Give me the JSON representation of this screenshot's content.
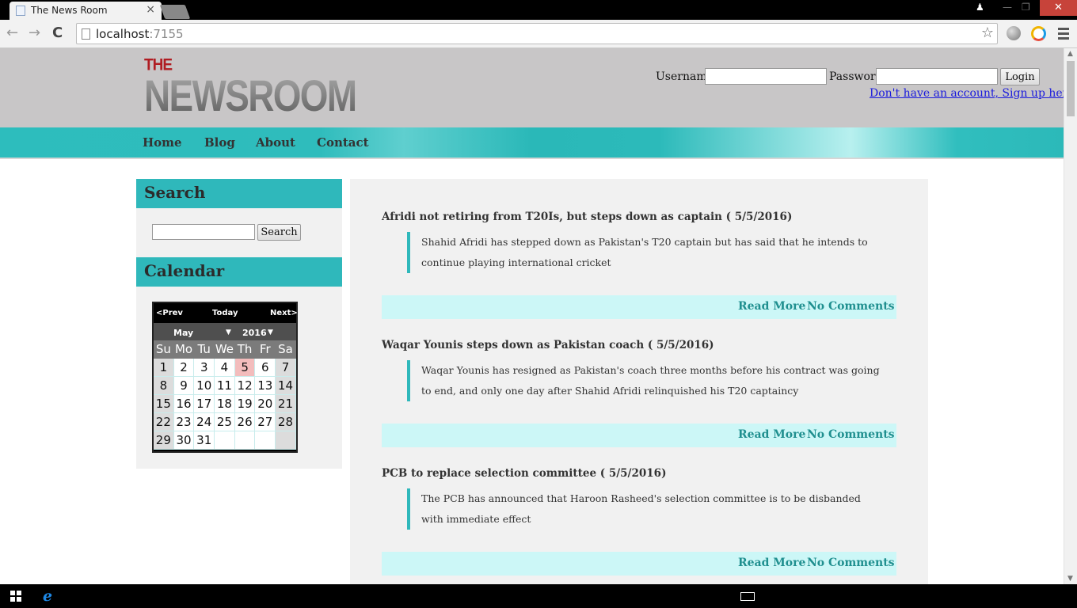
{
  "browser": {
    "tab_title": "The News Room",
    "tab_close": "×",
    "url_host": "localhost",
    "url_port": ":7155",
    "back": "←",
    "forward": "→",
    "reload": "C",
    "star": "☆"
  },
  "window": {
    "user_glyph": "♟",
    "min": "—",
    "max": "❐",
    "close": "✕"
  },
  "site": {
    "logo_the": "THE",
    "logo_news": "NEWSROOM",
    "login": {
      "username_label": "Username",
      "password_label": "Password",
      "button": "Login",
      "signup": "Don't have an account, Sign up here!"
    },
    "nav": [
      "Home",
      "Blog",
      "About",
      "Contact"
    ]
  },
  "sidebar": {
    "search_title": "Search",
    "search_button": "Search",
    "calendar_title": "Calendar"
  },
  "calendar": {
    "prev": "<Prev",
    "today": "Today",
    "next": "Next>",
    "month": "May",
    "year": "2016",
    "days": [
      "Su",
      "Mo",
      "Tu",
      "We",
      "Th",
      "Fr",
      "Sa"
    ],
    "weeks": [
      [
        "1",
        "2",
        "3",
        "4",
        "5",
        "6",
        "7"
      ],
      [
        "8",
        "9",
        "10",
        "11",
        "12",
        "13",
        "14"
      ],
      [
        "15",
        "16",
        "17",
        "18",
        "19",
        "20",
        "21"
      ],
      [
        "22",
        "23",
        "24",
        "25",
        "26",
        "27",
        "28"
      ],
      [
        "29",
        "30",
        "31",
        "",
        "",
        "",
        ""
      ]
    ],
    "highlighted_day": "5"
  },
  "articles": [
    {
      "title": "Afridi not retiring from T20Is, but steps down as captain ( 5/5/2016)",
      "summary": "Shahid Afridi has stepped down as Pakistan's T20 captain but has said that he intends to continue playing international cricket",
      "read_more": "Read More",
      "comments": "No Comments"
    },
    {
      "title": "Waqar Younis steps down as Pakistan coach ( 5/5/2016)",
      "summary": "Waqar Younis has resigned as Pakistan's coach three months before his contract was going to end, and only one day after Shahid Afridi relinquished his T20 captaincy",
      "read_more": "Read More",
      "comments": "No Comments"
    },
    {
      "title": "PCB to replace selection committee ( 5/5/2016)",
      "summary": "The PCB has announced that Haroon Rasheed's selection committee is to be disbanded with immediate effect",
      "read_more": "Read More",
      "comments": "No Comments"
    }
  ],
  "colors": {
    "accent": "#2fb8bb",
    "header_bg": "#c8c6c7",
    "link_bar": "#ccf7f7",
    "logo_red": "#b01c22"
  }
}
